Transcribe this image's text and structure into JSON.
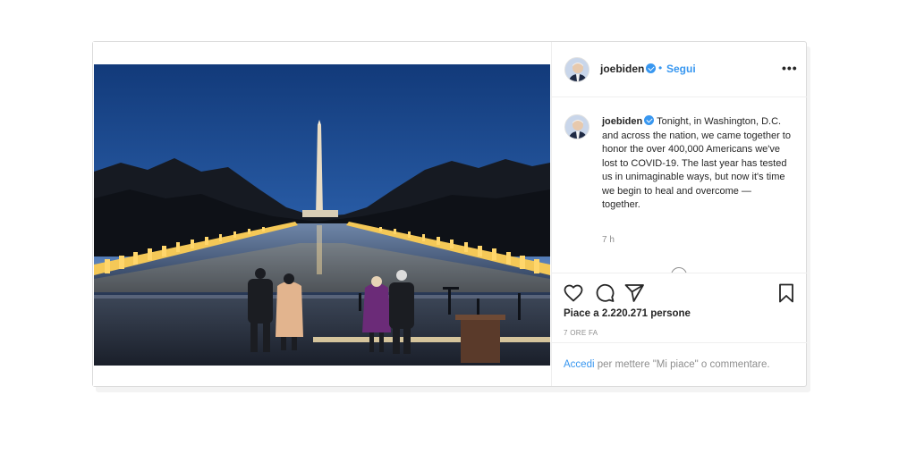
{
  "post": {
    "username": "joebiden",
    "dot": "•",
    "follow_label": "Segui",
    "more_label": "•••",
    "caption_text": "Tonight, in Washington, D.C. and across the nation, we came together to honor the over 400,000 Americans we've lost to COVID-19. The last year has tested us in unimaginable ways, but now it's time we begin to heal and overcome — together.",
    "time": "7 h",
    "likes": "Piace a 2.220.271 persone",
    "time_ago": "7 ORE FA",
    "login_link": "Accedi",
    "login_rest": " per mettere \"Mi piace\" o commentare."
  },
  "icons": {
    "like": "heart-icon",
    "comment": "comment-icon",
    "share": "paper-plane-icon",
    "save": "bookmark-icon",
    "verified": "verified-badge-icon",
    "more": "more-options-icon"
  },
  "colors": {
    "link": "#3897f0",
    "text": "#262626",
    "muted": "#8e8e8e",
    "border": "#dbdbdb"
  }
}
